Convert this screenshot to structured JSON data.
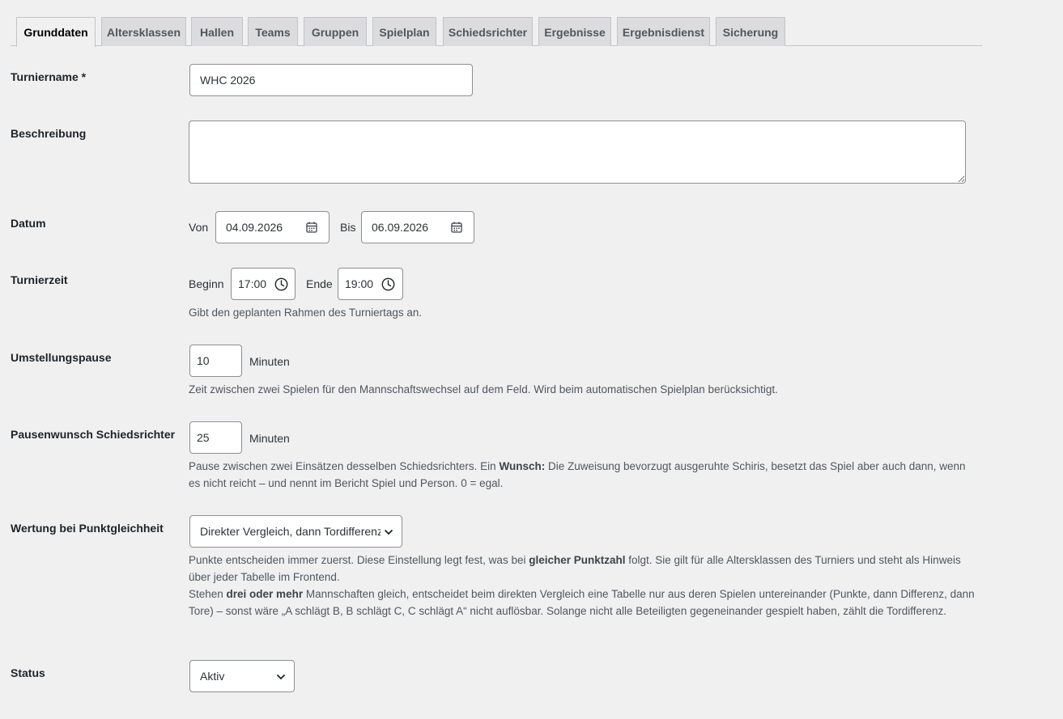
{
  "tabs": [
    {
      "label": "Grunddaten",
      "active": true
    },
    {
      "label": "Altersklassen"
    },
    {
      "label": "Hallen"
    },
    {
      "label": "Teams"
    },
    {
      "label": "Gruppen"
    },
    {
      "label": "Spielplan"
    },
    {
      "label": "Schiedsrichter"
    },
    {
      "label": "Ergebnisse"
    },
    {
      "label": "Ergebnisdienst"
    },
    {
      "label": "Sicherung"
    }
  ],
  "form": {
    "turniername": {
      "label": "Turniername *",
      "value": "WHC 2026"
    },
    "beschreibung": {
      "label": "Beschreibung",
      "value": ""
    },
    "datum": {
      "label": "Datum",
      "von_label": "Von",
      "von": "04.09.2026",
      "bis_label": "Bis",
      "bis": "06.09.2026"
    },
    "turnierzeit": {
      "label": "Turnierzeit",
      "beginn_label": "Beginn",
      "beginn": "17:00",
      "ende_label": "Ende",
      "ende": "19:00",
      "hint": "Gibt den geplanten Rahmen des Turniertags an."
    },
    "umstellungspause": {
      "label": "Umstellungspause",
      "value": "10",
      "unit": "Minuten",
      "hint": "Zeit zwischen zwei Spielen für den Mannschaftswechsel auf dem Feld. Wird beim automatischen Spielplan berücksichtigt."
    },
    "pausenwunsch": {
      "label": "Pausenwunsch Schiedsrichter",
      "value": "25",
      "unit": "Minuten",
      "hint_a": "Pause zwischen zwei Einsätzen desselben Schiedsrichters. Ein ",
      "hint_b": "Wunsch:",
      "hint_c": " Die Zuweisung bevorzugt ausgeruhte Schiris, besetzt das Spiel aber auch dann, wenn es nicht reicht – und nennt im Bericht Spiel und Person. 0 = egal."
    },
    "wertung": {
      "label": "Wertung bei Punktgleichheit",
      "value": "Direkter Vergleich, dann Tordifferenz",
      "hint1_a": "Punkte entscheiden immer zuerst. Diese Einstellung legt fest, was bei ",
      "hint1_b": "gleicher Punktzahl",
      "hint1_c": " folgt. Sie gilt für alle Altersklassen des Turniers und steht als Hinweis über jeder Tabelle im Frontend.",
      "hint2_a": "Stehen ",
      "hint2_b": "drei oder mehr",
      "hint2_c": " Mannschaften gleich, entscheidet beim direkten Vergleich eine Tabelle nur aus deren Spielen untereinander (Punkte, dann Differenz, dann Tore) – sonst wäre „A schlägt B, B schlägt C, C schlägt A“ nicht auflösbar. Solange nicht alle Beteiligten gegeneinander gespielt haben, zählt die Tordifferenz."
    },
    "status": {
      "label": "Status",
      "value": "Aktiv"
    }
  }
}
